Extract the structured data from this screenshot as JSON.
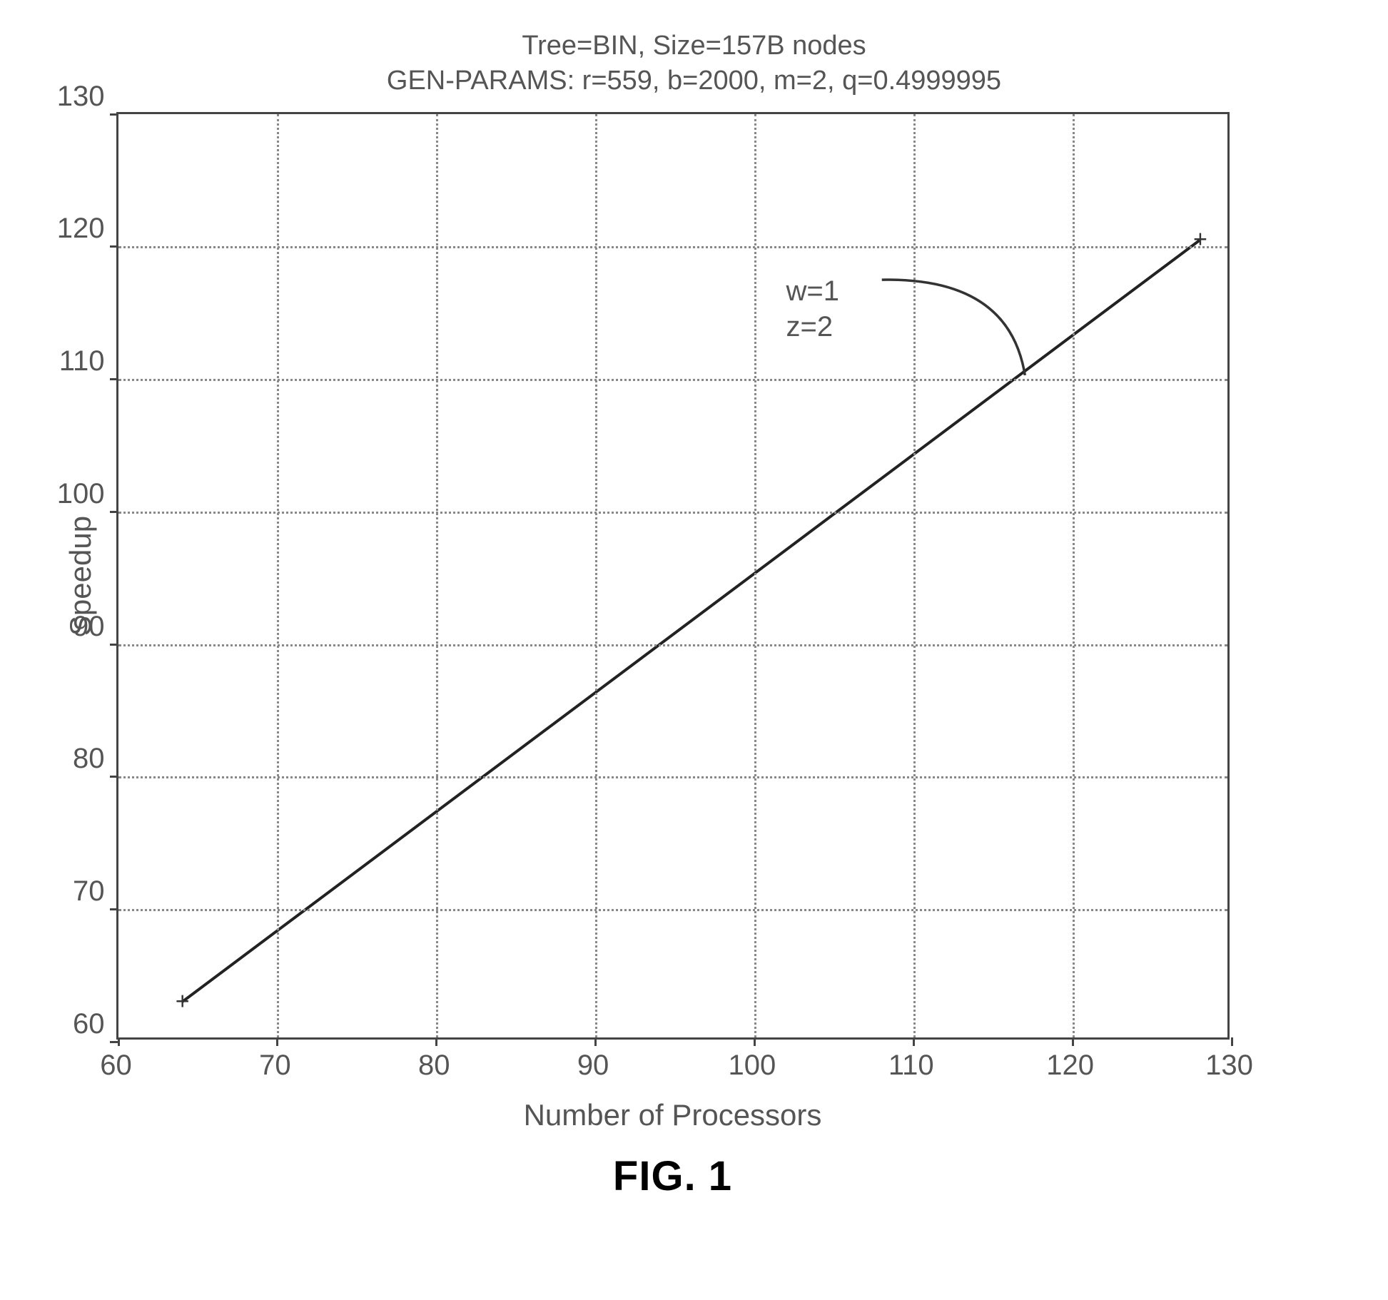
{
  "chart_data": {
    "type": "line",
    "title_line1": "Tree=BIN, Size=157B nodes",
    "title_line2": "GEN-PARAMS: r=559, b=2000, m=2, q=0.4999995",
    "xlabel": "Number of Processors",
    "ylabel": "Speedup",
    "x_ticks": [
      60,
      70,
      80,
      90,
      100,
      110,
      120,
      130
    ],
    "y_ticks": [
      60,
      70,
      80,
      90,
      100,
      110,
      120,
      130
    ],
    "xlim": [
      60,
      130
    ],
    "ylim": [
      60,
      130
    ],
    "series": [
      {
        "name": "w=1, z=2",
        "x": [
          64,
          128
        ],
        "values": [
          63,
          120.5
        ]
      }
    ],
    "annotation": {
      "text_line1": "w=1",
      "text_line2": "z=2"
    },
    "figure_caption": "FIG. 1"
  }
}
